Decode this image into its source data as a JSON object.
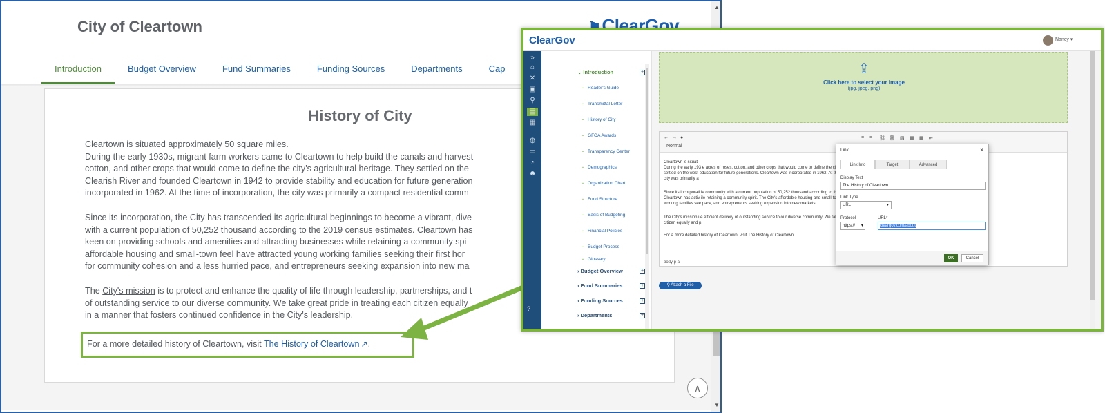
{
  "site": {
    "title": "City of Cleartown",
    "logo": "ClearGov",
    "tabs": [
      {
        "label": "Introduction"
      },
      {
        "label": "Budget Overview"
      },
      {
        "label": "Fund Summaries"
      },
      {
        "label": "Funding Sources"
      },
      {
        "label": "Departments"
      },
      {
        "label": "Cap"
      }
    ],
    "heading": "History of City",
    "para1": "Cleartown is situated approximately 50 square miles.\nDuring the early 1930s, migrant farm workers came to Cleartown to help build the canals and harvest\ncotton, and other crops that would come to define the city's agricultural heritage. They settled on the\nClearish River and founded Cleartown in 1942 to provide stability and education for future generation\nincorporated in 1962.  At the time of incorporation, the city was primarily a compact residential comm",
    "para2": "Since its incorporation, the City has transcended its agricultural beginnings to become a vibrant, dive\nwith a current population of 50,252 thousand according to the 2019 census estimates. Cleartown has\nkeen on providing schools and amenities and attracting businesses while retaining a community spi\naffordable housing and small-town feel have attracted young working families seeking their first hor\nfor community cohesion and a less hurried pace, and entrepreneurs seeking expansion into new ma",
    "para3_pre": "The ",
    "para3_link": "City's mission",
    "para3_post": " is to protect and enhance the quality of life through leadership, partnerships, and t\nof outstanding service to our diverse community.  We take great pride in treating each citizen equally\nin a manner that fosters continued confidence in the City's leadership.",
    "callout_pre": "For a more detailed history of Cleartown, visit ",
    "callout_link": "The History of Cleartown",
    "callout_post": "."
  },
  "editor": {
    "logo": "ClearGov",
    "user": "Nancy",
    "nav": {
      "introduction": "Introduction",
      "items": [
        "Reader's Guide",
        "Transmittal Letter",
        "History of City",
        "GFOA Awards",
        "Transparency Center",
        "Demographics",
        "Organization Chart",
        "Fund Structure",
        "Basis of Budgeting",
        "Financial Policies",
        "Budget Process",
        "Glossary"
      ],
      "sections": [
        "Budget Overview",
        "Fund Summaries",
        "Funding Sources",
        "Departments"
      ]
    },
    "upload_title": "Click here to select your image",
    "upload_sub": "(jpg, jpeg, png)",
    "toolbar_format": "Normal",
    "rte_lines": [
      "Cleartown is situat",
      "During the early 193                                                                                                         e acres of roses, cotton, and other crops that would come to define the city's agricultural heritage. They",
      "settled on the west                                                                                                            education for future generations. Cleartown was incorporated in 1962.  At the time of incorporation, the",
      "city was primarily a",
      "",
      "Since its incorporati                                                                                                          le community with a current population of 50,252 thousand according to the 2019 census estimates.",
      "Cleartown has activ                                                                                                            ile retaining a community spirit. The City's affordable housing and small-town feel have attracted young",
      "working families see                                                                                                           pace, and entrepreneurs seeking expansion into new markets.",
      "",
      "The City's mission i                                                                                                           e efficient delivery of outstanding service to our diverse community.  We take great pride in treating each",
      "citizen equally and                                                                                                            p.",
      "",
      "For a more detailed history of Cleartown, visit The History of Cleartown"
    ],
    "rte_path": "body  p  a",
    "attach_label": "Attach a File",
    "dialog": {
      "title": "Link",
      "tabs": [
        "Link Info",
        "Target",
        "Advanced"
      ],
      "display_text_label": "Display Text",
      "display_text_value": "The History of Cleartown",
      "link_type_label": "Link Type",
      "link_type_value": "URL",
      "protocol_label": "Protocol",
      "protocol_value": "https://",
      "url_label": "URL*",
      "url_value": "cleargov.com/about",
      "ok_label": "OK",
      "cancel_label": "Cancel"
    }
  },
  "colors": {
    "accent_green": "#7cb342",
    "link_blue": "#1f5fa8",
    "nav_dark": "#1f4e7a"
  }
}
